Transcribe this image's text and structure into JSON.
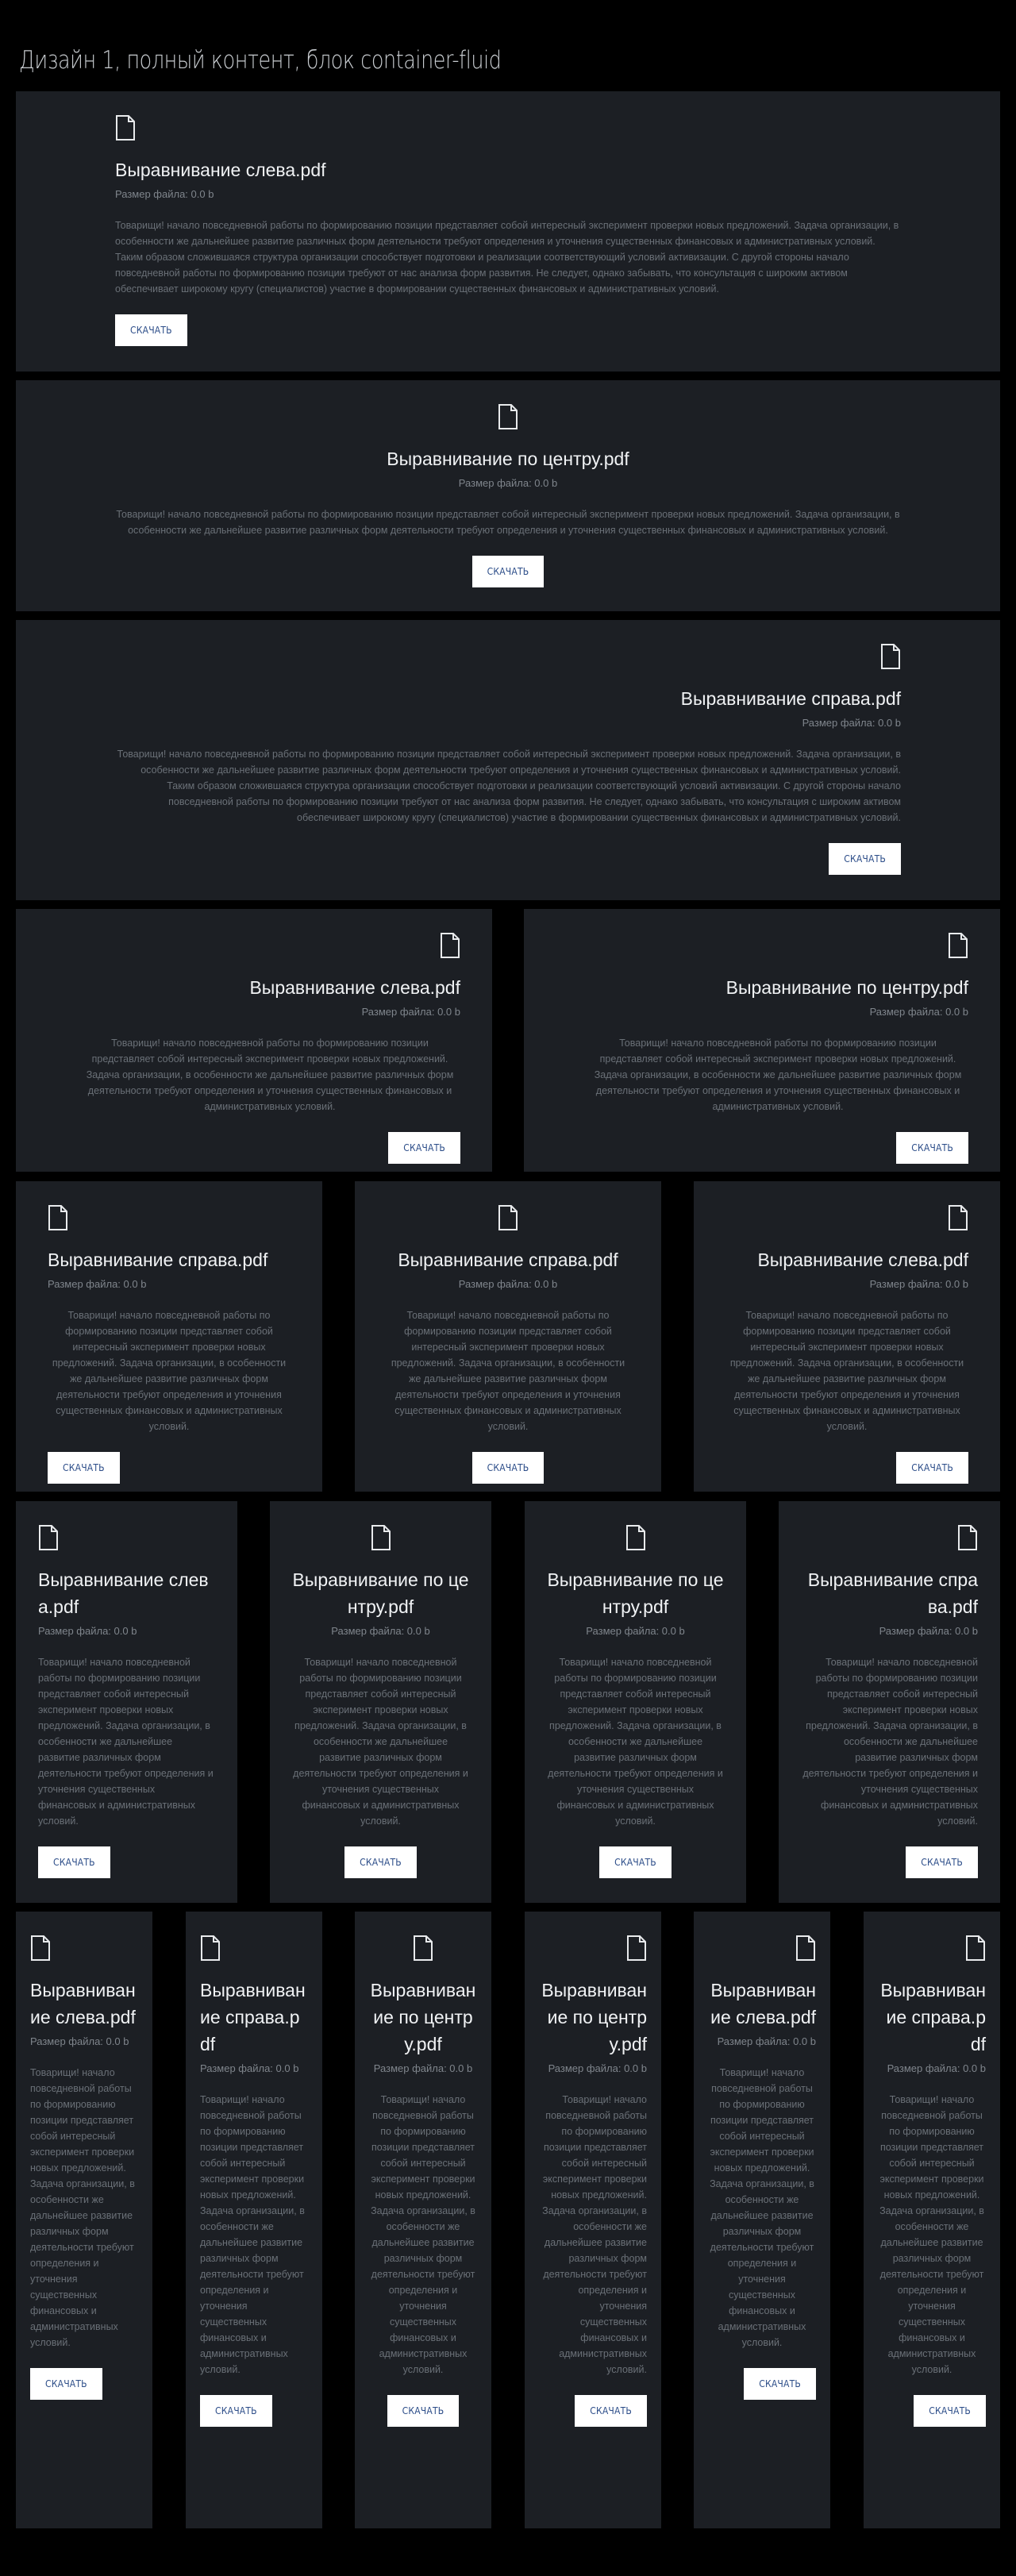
{
  "page": {
    "title": "Дизайн 1, полный контент, блок container-fluid"
  },
  "common": {
    "size_text": "Размер файла: 0.0 b",
    "button_label": "СКАЧАТЬ",
    "body_long": "Товарищи! начало повседневной работы по формированию позиции представляет собой интересный эксперимент проверки новых предложений. Задача организации, в особенности же дальнейшее развитие различных форм деятельности требуют определения и уточнения существенных финансовых и административных условий. Таким образом сложившаяся структура организации способствует подготовки и реализации соответствующий условий активизации. С другой стороны начало повседневной работы по формированию позиции требуют от нас анализа форм развития. Не следует, однако забывать, что консультация с широким активом обеспечивает широкому кругу (специалистов) участие в формировании существенных финансовых и административных условий.",
    "body_short": "Товарищи! начало повседневной работы по формированию позиции представляет собой интересный эксперимент проверки новых предложений. Задача организации, в особенности же дальнейшее развитие различных форм деятельности требуют определения и уточнения существенных финансовых и административных условий."
  },
  "cards": {
    "row1": [
      {
        "title": "Выравнивание слева.pdf"
      }
    ],
    "row2": [
      {
        "title": "Выравнивание по центру.pdf"
      }
    ],
    "row3": [
      {
        "title": "Выравнивание справа.pdf"
      }
    ],
    "row4": [
      {
        "title": "Выравнивание слева.pdf"
      },
      {
        "title": "Выравнивание по центру.pdf"
      }
    ],
    "row5": [
      {
        "title": "Выравнивание справа.pdf"
      },
      {
        "title": "Выравнивание справа.pdf"
      },
      {
        "title": "Выравнивание слева.pdf"
      }
    ],
    "row6": [
      {
        "title": "Выравнивание слева.pdf"
      },
      {
        "title": "Выравнивание по центру.pdf"
      },
      {
        "title": "Выравнивание по центру.pdf"
      },
      {
        "title": "Выравнивание справа.pdf"
      }
    ],
    "row7": [
      {
        "title": "Выравнивание слева.pdf"
      },
      {
        "title": "Выравнивание справа.pdf"
      },
      {
        "title": "Выравнивание по центру.pdf"
      },
      {
        "title": "Выравнивание по центру.pdf"
      },
      {
        "title": "Выравнивание слева.pdf"
      },
      {
        "title": "Выравнивание справа.pdf"
      }
    ]
  },
  "icons": {
    "file": "file-icon"
  },
  "colors": {
    "background": "#000000",
    "card": "#1c1f24",
    "button_bg": "#ffffff",
    "button_text": "#2b4c88"
  }
}
